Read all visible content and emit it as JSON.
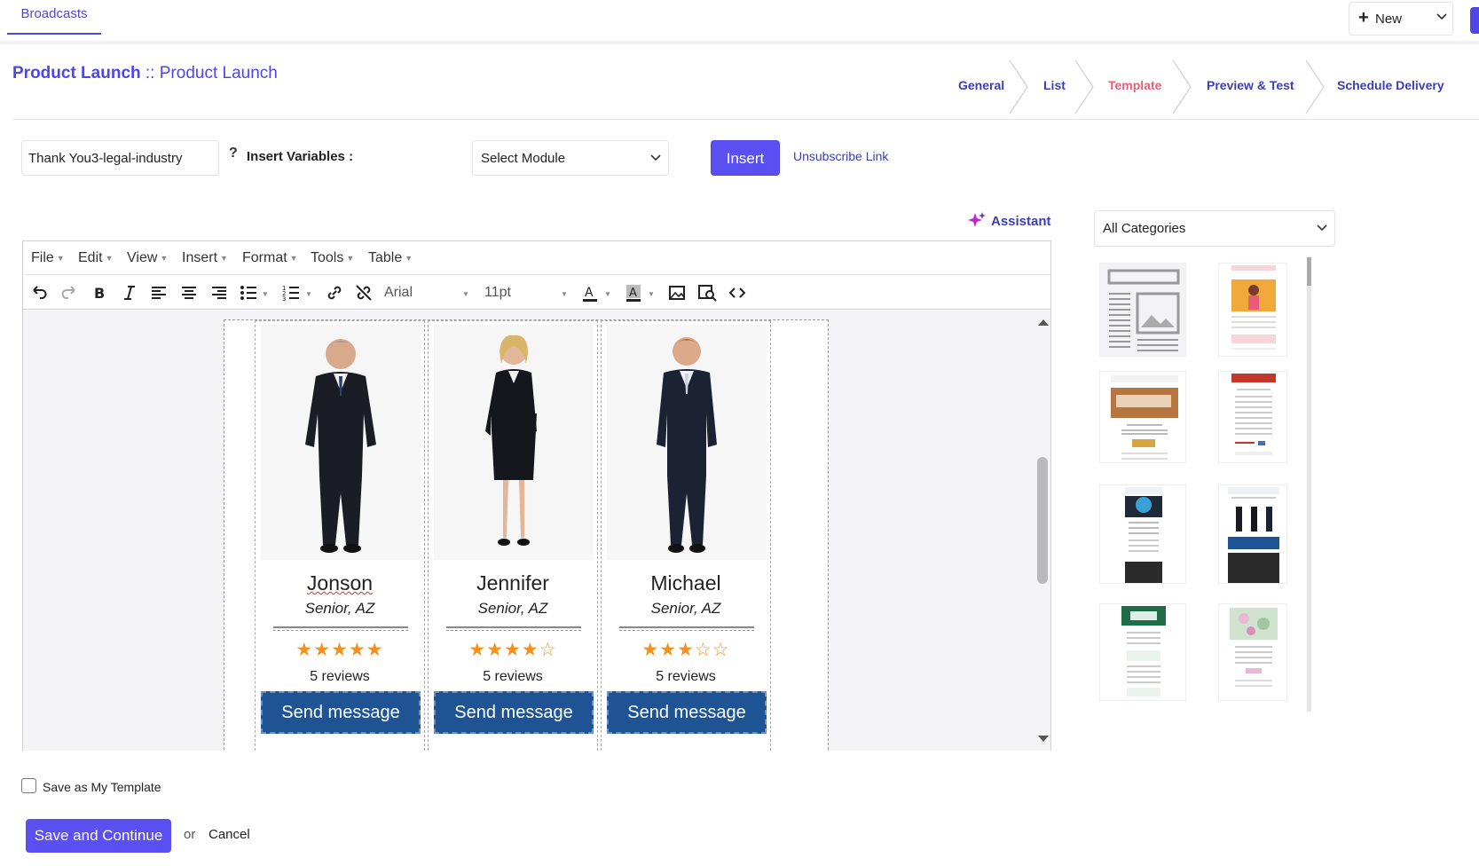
{
  "topbar": {
    "tab": "Broadcasts",
    "new_label": "New"
  },
  "page": {
    "title_bold": "Product Launch",
    "title_sep": " :: ",
    "title_rest": "Product Launch"
  },
  "steps": [
    "General",
    "List",
    "Template",
    "Preview & Test",
    "Schedule Delivery"
  ],
  "active_step": "Template",
  "template_name": "Thank You3-legal-industry",
  "insert_variables_label": "Insert Variables :",
  "select_module": "Select Module",
  "insert_label": "Insert",
  "unsubscribe_label": "Unsubscribe Link",
  "assistant_label": "Assistant",
  "editor": {
    "menu": [
      "File",
      "Edit",
      "View",
      "Insert",
      "Format",
      "Tools",
      "Table"
    ],
    "font": "Arial",
    "size": "11pt"
  },
  "cards": [
    {
      "name": "Jonson",
      "role": "Senior, AZ",
      "rating": 5,
      "stars": "★★★★★",
      "reviews": "5 reviews",
      "button": "Send message"
    },
    {
      "name": "Jennifer",
      "role": "Senior, AZ",
      "rating": 4,
      "stars": "★★★★☆",
      "reviews": "5 reviews",
      "button": "Send message"
    },
    {
      "name": "Michael",
      "role": "Senior, AZ",
      "rating": 3,
      "stars": "★★★☆☆",
      "reviews": "5 reviews",
      "button": "Send message"
    }
  ],
  "categories_select": "All Categories",
  "footer": {
    "save_template": "Save as My Template",
    "save_continue": "Save and Continue",
    "or": "or",
    "cancel": "Cancel"
  },
  "colors": {
    "accent": "#5a4ff0",
    "active_step": "#e85d75",
    "button_blue": "#1f5494",
    "star": "#f4911e"
  }
}
